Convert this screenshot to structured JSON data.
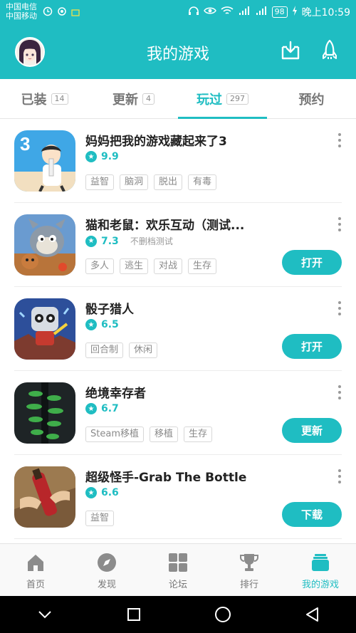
{
  "status_bar": {
    "carrier1": "中国电信",
    "carrier2": "中国移动",
    "battery": "98",
    "time": "晚上10:59"
  },
  "header": {
    "title": "我的游戏"
  },
  "tabs": [
    {
      "label": "已装",
      "count": "14"
    },
    {
      "label": "更新",
      "count": "4"
    },
    {
      "label": "玩过",
      "count": "297"
    },
    {
      "label": "预约",
      "count": ""
    }
  ],
  "games": [
    {
      "name": "妈妈把我的游戏藏起来了3",
      "rating": "9.9",
      "note": "",
      "tags": [
        "益智",
        "脑洞",
        "脱出",
        "有毒"
      ],
      "action": ""
    },
    {
      "name": "猫和老鼠：欢乐互动（测试...",
      "rating": "7.3",
      "note": "不删档测试",
      "tags": [
        "多人",
        "逃生",
        "对战",
        "生存"
      ],
      "action": "打开"
    },
    {
      "name": "骰子猎人",
      "rating": "6.5",
      "note": "",
      "tags": [
        "回合制",
        "休闲"
      ],
      "action": "打开"
    },
    {
      "name": "绝境幸存者",
      "rating": "6.7",
      "note": "",
      "tags": [
        "Steam移植",
        "移植",
        "生存"
      ],
      "action": "更新"
    },
    {
      "name": "超级怪手-Grab The Bottle",
      "rating": "6.6",
      "note": "",
      "tags": [
        "益智"
      ],
      "action": "下载"
    }
  ],
  "bottom_nav": [
    {
      "label": "首页",
      "icon": "home-icon"
    },
    {
      "label": "发现",
      "icon": "compass-icon"
    },
    {
      "label": "论坛",
      "icon": "grid-icon"
    },
    {
      "label": "排行",
      "icon": "trophy-icon"
    },
    {
      "label": "我的游戏",
      "icon": "stack-icon"
    }
  ],
  "colors": {
    "accent": "#1fbdc2"
  }
}
